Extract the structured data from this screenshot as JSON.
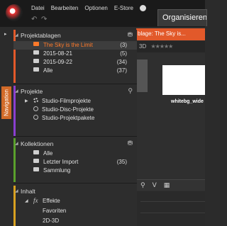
{
  "menu": {
    "items": [
      "Datei",
      "Bearbeiten",
      "Optionen",
      "E-Store"
    ],
    "help_glyph": "?",
    "undo_glyph": "↶",
    "redo_glyph": "↷",
    "organize_tab": "Organisieren"
  },
  "workspace": {
    "orange_tab": "blage: The Sky is...",
    "tool_row": "3D",
    "stars": "★★★★★",
    "thumb_caption": "whitebg_wide"
  },
  "navigation": {
    "side_label": "Navigation",
    "sections": [
      {
        "title": "Projektablagen",
        "items": [
          {
            "label": "The Sky is the Limit",
            "count": "(3)"
          },
          {
            "label": "2015-08-21",
            "count": "(5)"
          },
          {
            "label": "2015-09-22",
            "count": "(34)"
          },
          {
            "label": "Alle",
            "count": "(37)"
          }
        ]
      },
      {
        "title": "Projekte",
        "items": [
          {
            "label": "Studio-Filmprojekte"
          },
          {
            "label": "Studio-Disc-Projekte"
          },
          {
            "label": "Studio-Projektpakete"
          }
        ]
      },
      {
        "title": "Kollektionen",
        "items": [
          {
            "label": "Alle",
            "count": ""
          },
          {
            "label": "Letzter Import",
            "count": "(35)"
          },
          {
            "label": "Sammlung",
            "count": ""
          }
        ]
      },
      {
        "title": "Inhalt",
        "items": [
          {
            "label": "Effekte"
          },
          {
            "label": "Favoriten"
          },
          {
            "label": "2D-3D"
          }
        ]
      }
    ]
  },
  "colors": {
    "projektablagen": "#e2592a",
    "projekte": "#8a3fd0",
    "kollektionen": "#5aa02c",
    "inhalt": "#d8a020"
  }
}
